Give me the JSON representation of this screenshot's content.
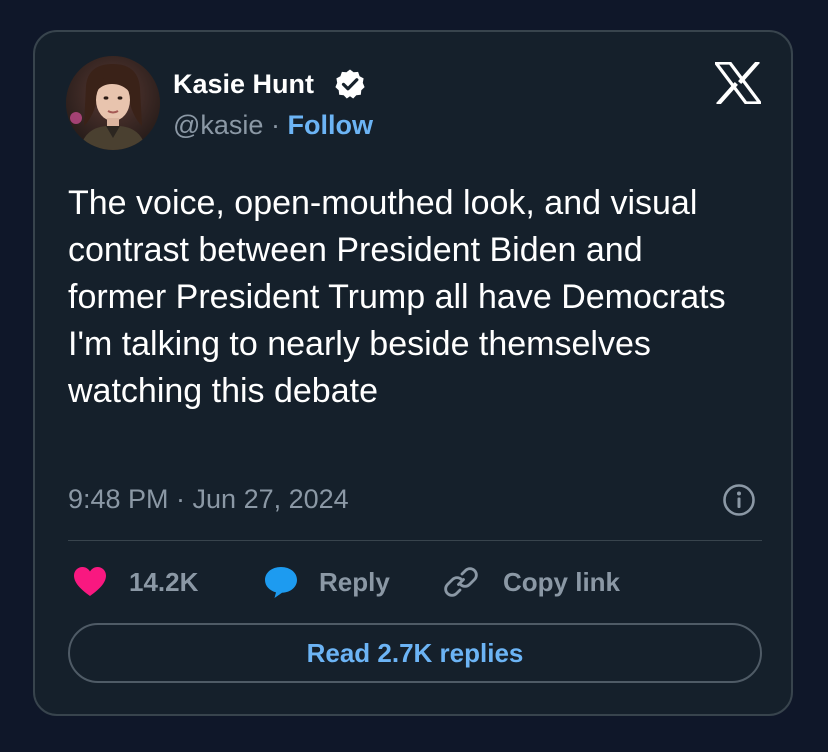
{
  "tweet": {
    "author": {
      "name": "Kasie Hunt",
      "handle": "@kasie",
      "separator": "·",
      "follow_label": "Follow"
    },
    "text": "The voice, open-mouthed look, and visual contrast between President Biden and former President Trump all have Democrats I'm talking to nearly beside themselves watching this debate",
    "timestamp": "9:48 PM · Jun 27, 2024",
    "actions": {
      "likes": "14.2K",
      "reply_label": "Reply",
      "copy_link_label": "Copy link"
    },
    "read_replies_label": "Read 2.7K replies"
  },
  "icons": {
    "verified": "verified-badge-icon",
    "x_logo": "x-logo-icon",
    "info": "info-icon",
    "like": "heart-icon",
    "reply": "speech-bubble-icon",
    "copy_link": "link-icon"
  },
  "colors": {
    "background": "#0f1729",
    "card": "#15202b",
    "border": "#38444d",
    "text_primary": "#ffffff",
    "text_secondary": "#8b98a5",
    "link_blue": "#6cb4f5",
    "heart_pink": "#f91880",
    "reply_blue": "#1d9bf0"
  }
}
